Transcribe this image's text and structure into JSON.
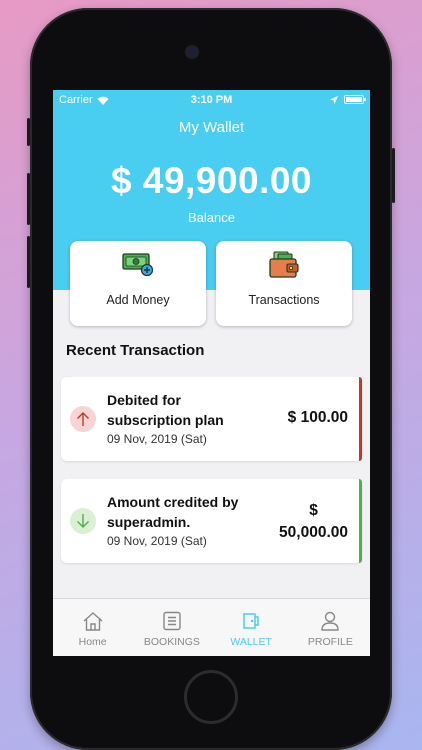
{
  "status_bar": {
    "carrier": "Carrier",
    "time": "3:10 PM"
  },
  "header": {
    "title": "My Wallet",
    "amount": "$ 49,900.00",
    "balance_label": "Balance"
  },
  "actions": [
    {
      "label": "Add Money",
      "icon": "money-add-icon"
    },
    {
      "label": "Transactions",
      "icon": "wallet-icon"
    }
  ],
  "recent": {
    "title": "Recent Transaction",
    "items": [
      {
        "description": "Debited for subscription plan",
        "date": "09 Nov, 2019 (Sat)",
        "amount": "$ 100.00",
        "type": "debit",
        "color": "#c0392b"
      },
      {
        "description": "Amount credited by superadmin.",
        "date": "09 Nov, 2019 (Sat)",
        "amount_line1": "$",
        "amount_line2": "50,000.00",
        "type": "credit",
        "color": "#4caf50"
      }
    ]
  },
  "tabs": [
    {
      "label": "Home",
      "icon": "home-icon",
      "active": false
    },
    {
      "label": "BOOKINGS",
      "icon": "list-icon",
      "active": false
    },
    {
      "label": "WALLET",
      "icon": "wallet-icon",
      "active": true
    },
    {
      "label": "PROFILE",
      "icon": "user-icon",
      "active": false
    }
  ],
  "colors": {
    "accent": "#49cdf0",
    "debit": "#c0392b",
    "credit": "#4caf50"
  }
}
